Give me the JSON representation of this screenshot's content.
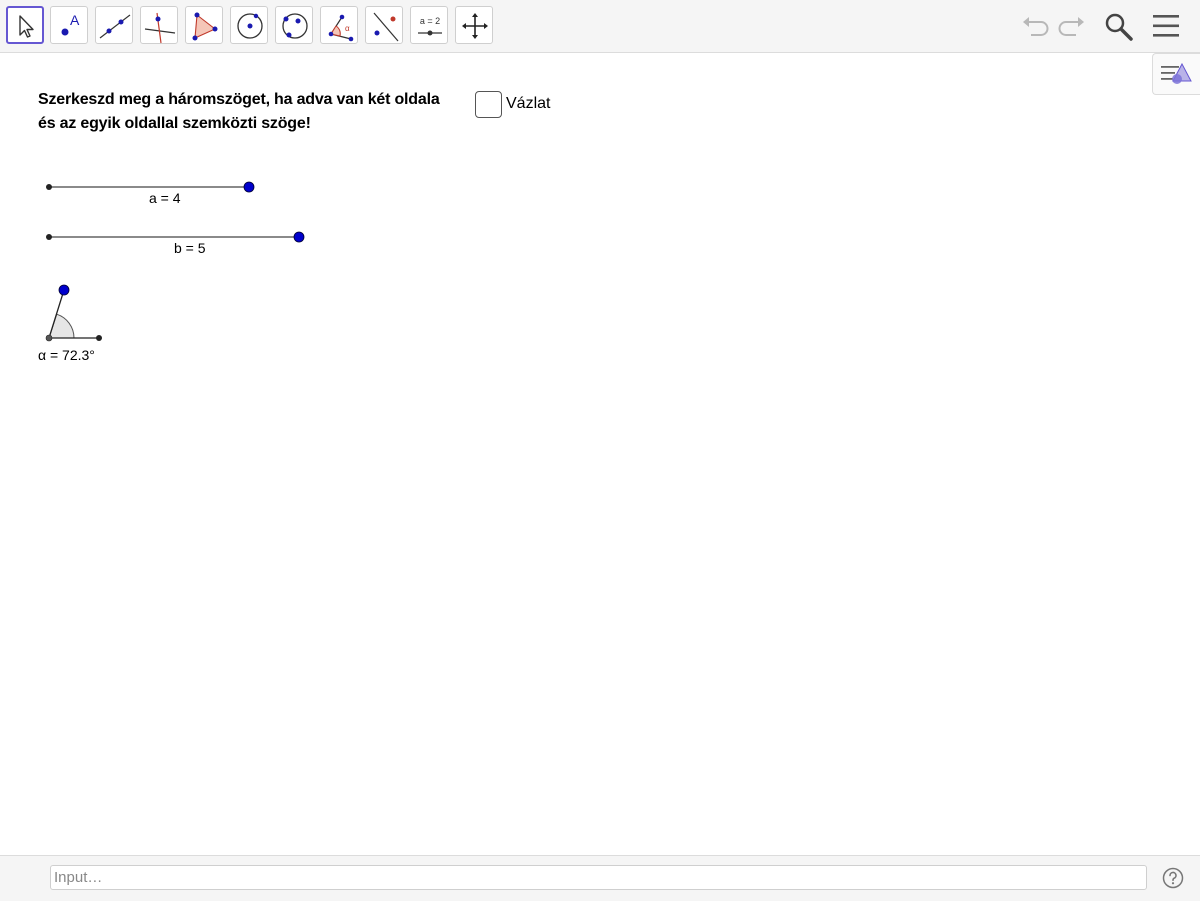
{
  "toolbar": {
    "tools": [
      {
        "name": "move-tool-icon"
      },
      {
        "name": "point-tool-icon",
        "glyph": "A"
      },
      {
        "name": "line-tool-icon"
      },
      {
        "name": "perpendicular-line-tool-icon"
      },
      {
        "name": "polygon-tool-icon"
      },
      {
        "name": "circle-center-point-tool-icon"
      },
      {
        "name": "circle-three-points-tool-icon"
      },
      {
        "name": "angle-tool-icon",
        "glyph": "α"
      },
      {
        "name": "reflect-tool-icon"
      },
      {
        "name": "slider-tool-icon",
        "glyph": "a = 2"
      },
      {
        "name": "move-graphics-view-tool-icon"
      }
    ],
    "right_icons": [
      "undo-icon",
      "redo-icon",
      "search-icon",
      "menu-icon"
    ]
  },
  "canvas": {
    "task_line1": "Szerkeszd meg a háromszöget, ha adva van két oldala",
    "task_line2": "és az egyik oldallal szemközti szöge!",
    "checkbox": {
      "label": "Vázlat",
      "checked": false
    },
    "segment_a_label": "a = 4",
    "segment_b_label": "b = 5",
    "angle_label": "α = 72.3°",
    "style_bar_icon": "style-bar-toggle-icon"
  },
  "colors": {
    "accent": "#6557d2",
    "free_point": "#0000cc",
    "dependent_point": "#333333"
  },
  "input_bar": {
    "placeholder": "Input…",
    "help_icon": "help-icon"
  }
}
